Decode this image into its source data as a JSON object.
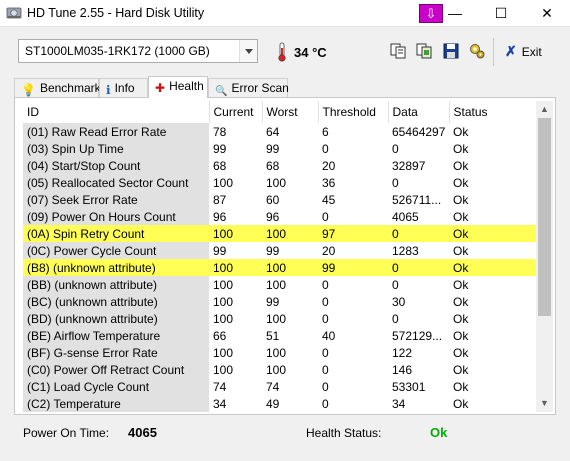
{
  "window": {
    "title": "HD Tune 2.55 - Hard Disk Utility",
    "minimize_glyph": "—",
    "maximize_glyph": "☐",
    "close_glyph": "✕",
    "special_glyph": "⇩"
  },
  "toolbar": {
    "drive": "ST1000LM035-1RK172 (1000 GB)",
    "temperature": "34 °C",
    "exit_label": "Exit",
    "exit_glyph": "✗"
  },
  "tabs": [
    {
      "label": "Benchmark",
      "icon": "benchmark-icon",
      "glyph": "💡"
    },
    {
      "label": "Info",
      "icon": "info-icon",
      "glyph": "ℹ"
    },
    {
      "label": "Health",
      "icon": "health-cross-icon",
      "glyph": "✚"
    },
    {
      "label": "Error Scan",
      "icon": "magnifier-icon",
      "glyph": "🔍"
    }
  ],
  "active_tab": "Health",
  "table": {
    "columns": [
      "ID",
      "Current",
      "Worst",
      "Threshold",
      "Data",
      "Status"
    ],
    "rows": [
      {
        "id": "(01) Raw Read Error Rate",
        "current": "78",
        "worst": "64",
        "threshold": "6",
        "data": "65464297",
        "status": "Ok",
        "highlight": false
      },
      {
        "id": "(03) Spin Up Time",
        "current": "99",
        "worst": "99",
        "threshold": "0",
        "data": "0",
        "status": "Ok",
        "highlight": false
      },
      {
        "id": "(04) Start/Stop Count",
        "current": "68",
        "worst": "68",
        "threshold": "20",
        "data": "32897",
        "status": "Ok",
        "highlight": false
      },
      {
        "id": "(05) Reallocated Sector Count",
        "current": "100",
        "worst": "100",
        "threshold": "36",
        "data": "0",
        "status": "Ok",
        "highlight": false
      },
      {
        "id": "(07) Seek Error Rate",
        "current": "87",
        "worst": "60",
        "threshold": "45",
        "data": "526711...",
        "status": "Ok",
        "highlight": false
      },
      {
        "id": "(09) Power On Hours Count",
        "current": "96",
        "worst": "96",
        "threshold": "0",
        "data": "4065",
        "status": "Ok",
        "highlight": false
      },
      {
        "id": "(0A) Spin Retry Count",
        "current": "100",
        "worst": "100",
        "threshold": "97",
        "data": "0",
        "status": "Ok",
        "highlight": true
      },
      {
        "id": "(0C) Power Cycle Count",
        "current": "99",
        "worst": "99",
        "threshold": "20",
        "data": "1283",
        "status": "Ok",
        "highlight": false
      },
      {
        "id": "(B8) (unknown attribute)",
        "current": "100",
        "worst": "100",
        "threshold": "99",
        "data": "0",
        "status": "Ok",
        "highlight": true
      },
      {
        "id": "(BB) (unknown attribute)",
        "current": "100",
        "worst": "100",
        "threshold": "0",
        "data": "0",
        "status": "Ok",
        "highlight": false
      },
      {
        "id": "(BC) (unknown attribute)",
        "current": "100",
        "worst": "99",
        "threshold": "0",
        "data": "30",
        "status": "Ok",
        "highlight": false
      },
      {
        "id": "(BD) (unknown attribute)",
        "current": "100",
        "worst": "100",
        "threshold": "0",
        "data": "0",
        "status": "Ok",
        "highlight": false
      },
      {
        "id": "(BE) Airflow Temperature",
        "current": "66",
        "worst": "51",
        "threshold": "40",
        "data": "572129...",
        "status": "Ok",
        "highlight": false
      },
      {
        "id": "(BF) G-sense Error Rate",
        "current": "100",
        "worst": "100",
        "threshold": "0",
        "data": "122",
        "status": "Ok",
        "highlight": false
      },
      {
        "id": "(C0) Power Off Retract Count",
        "current": "100",
        "worst": "100",
        "threshold": "0",
        "data": "146",
        "status": "Ok",
        "highlight": false
      },
      {
        "id": "(C1) Load Cycle Count",
        "current": "74",
        "worst": "74",
        "threshold": "0",
        "data": "53301",
        "status": "Ok",
        "highlight": false
      },
      {
        "id": "(C2) Temperature",
        "current": "34",
        "worst": "49",
        "threshold": "0",
        "data": "34",
        "status": "Ok",
        "highlight": false
      }
    ]
  },
  "footer": {
    "power_on_label": "Power On Time:",
    "power_on_value": "4065",
    "health_label": "Health Status:",
    "health_value": "Ok"
  },
  "colors": {
    "highlight": "#ffff55",
    "id_cell_bg": "#e1e1e1",
    "health_ok": "#00b000",
    "special_button": "#c800c8"
  },
  "scrollbar": {
    "up_glyph": "▲",
    "down_glyph": "▼"
  }
}
